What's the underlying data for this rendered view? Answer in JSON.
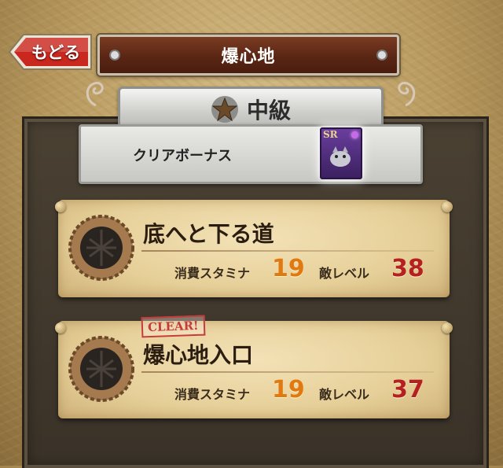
{
  "nav": {
    "back_label": "もどる"
  },
  "header": {
    "title": "爆心地"
  },
  "difficulty": {
    "label": "中級",
    "icon": "star-icon"
  },
  "clear_bonus": {
    "label": "クリアボーナス",
    "card_rarity": "SR"
  },
  "quests": [
    {
      "name": "底へと下る道",
      "stamina_label": "消費スタミナ",
      "stamina_value": "19",
      "enemy_level_label": "敵レベル",
      "enemy_level_value": "38",
      "cleared": false
    },
    {
      "name": "爆心地入口",
      "stamina_label": "消費スタミナ",
      "stamina_value": "19",
      "enemy_level_label": "敵レベル",
      "enemy_level_value": "37",
      "cleared": true,
      "clear_label": "CLEAR!"
    }
  ],
  "colors": {
    "stamina": "#e07a10",
    "enemy_level": "#b52020",
    "banner": "#5a2614",
    "back_button": "#c8281e"
  }
}
